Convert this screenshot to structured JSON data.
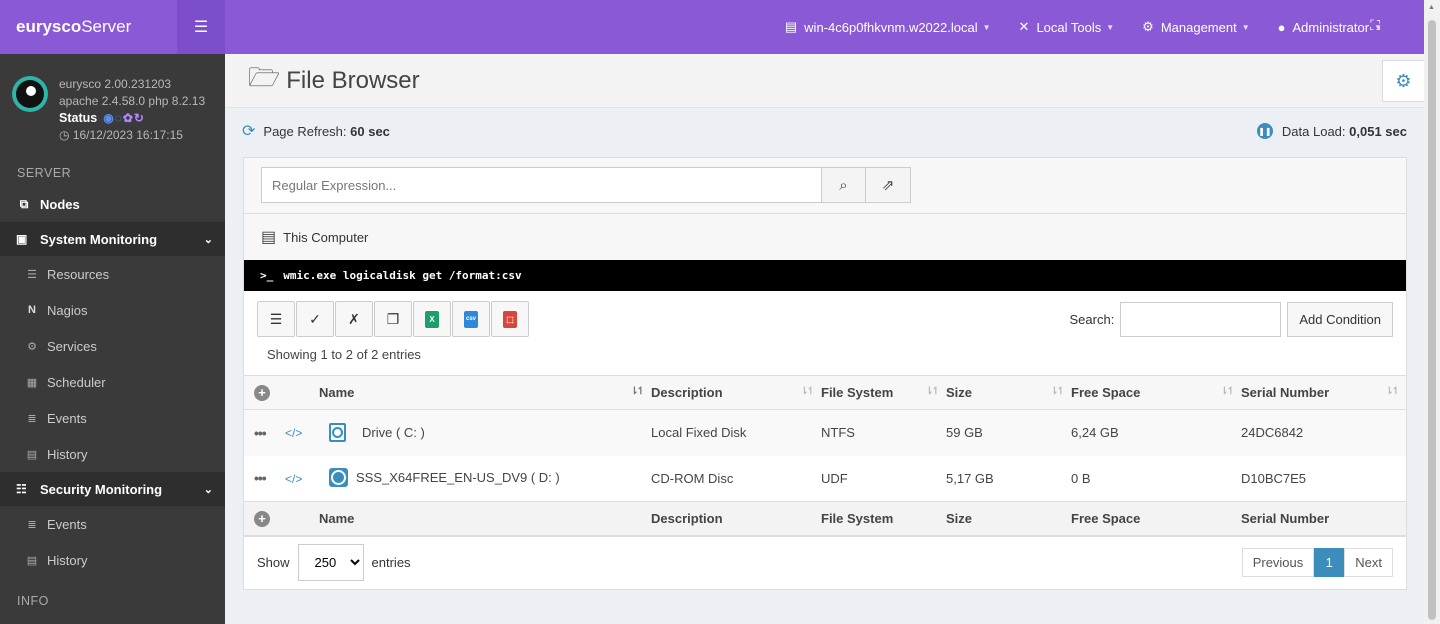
{
  "brand": {
    "name_bold": "eurysco",
    "name_light": "Server"
  },
  "colors": {
    "accent": "#8a5ad6",
    "link": "#3c8dbc"
  },
  "user_panel": {
    "version": "eurysco 2.00.231203",
    "stack": "apache 2.4.58.0  php 8.2.13",
    "status_label": "Status",
    "datetime": "16/12/2023 16:17:15"
  },
  "sidebar": {
    "server_header": "SERVER",
    "nodes_label": "Nodes",
    "system_monitoring": {
      "label": "System Monitoring",
      "items": [
        "Resources",
        "Nagios",
        "Services",
        "Scheduler",
        "Events",
        "History"
      ]
    },
    "security_monitoring": {
      "label": "Security Monitoring",
      "items": [
        "Events",
        "History"
      ]
    },
    "info_header": "INFO"
  },
  "topbar": {
    "host": "win-4c6p0fhkvnm.w2022.local",
    "local_tools": "Local Tools",
    "management": "Management",
    "user": "Administrator"
  },
  "page": {
    "title": "File Browser",
    "refresh_label": "Page Refresh:",
    "refresh_value": "60 sec",
    "data_load_label": "Data Load:",
    "data_load_value": "0,051 sec"
  },
  "search": {
    "placeholder": "Regular Expression..."
  },
  "computer_label": "This Computer",
  "command": "wmic.exe logicaldisk get /format:csv",
  "table_toolbar": {
    "search_label": "Search:",
    "add_condition": "Add Condition",
    "showing": "Showing 1 to 2 of 2 entries"
  },
  "table": {
    "columns": [
      "Name",
      "Description",
      "File System",
      "Size",
      "Free Space",
      "Serial Number"
    ],
    "rows": [
      {
        "name": "Drive ( C: )",
        "description": "Local Fixed Disk",
        "file_system": "NTFS",
        "size": "59 GB",
        "free_space": "6,24 GB",
        "serial": "24DC6842",
        "icon": "hard-drive-icon"
      },
      {
        "name": "SSS_X64FREE_EN-US_DV9 ( D: )",
        "description": "CD-ROM Disc",
        "file_system": "UDF",
        "size": "5,17 GB",
        "free_space": "0 B",
        "serial": "D10BC7E5",
        "icon": "cd-rom-icon"
      }
    ]
  },
  "footer": {
    "show_label": "Show",
    "entries_value": "250",
    "entries_label": "entries",
    "previous": "Previous",
    "page": "1",
    "next": "Next"
  }
}
